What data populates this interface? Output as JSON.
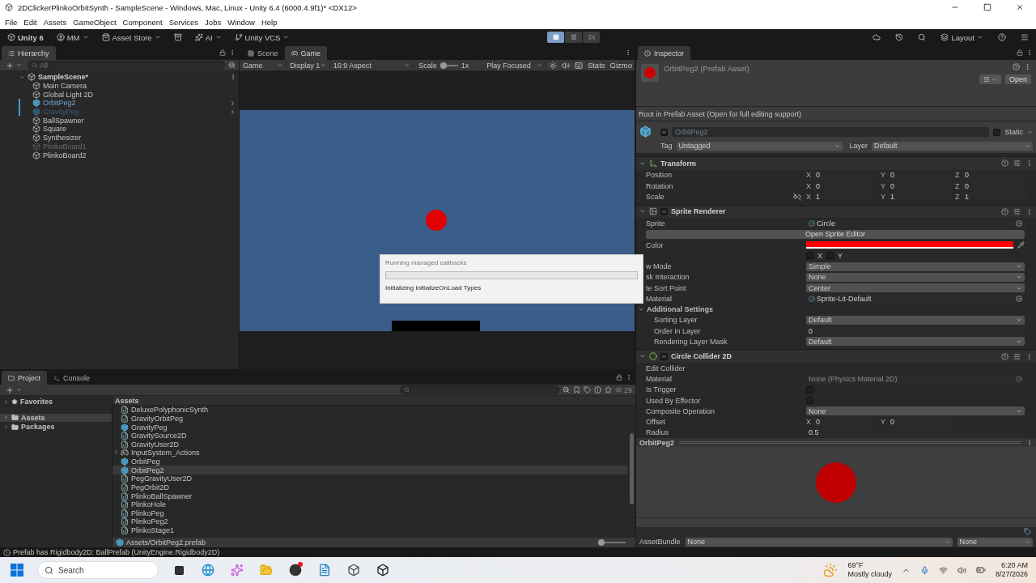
{
  "window": {
    "title": "2DClickerPlinkoOrbitSynth - SampleScene - Windows, Mac, Linux - Unity 6.4 (6000.4.9f1)* <DX12>"
  },
  "menu_bar": [
    "File",
    "Edit",
    "Assets",
    "GameObject",
    "Component",
    "Services",
    "Jobs",
    "Window",
    "Help"
  ],
  "toolbar": {
    "account": "Unity 6",
    "user": "MM",
    "asset_store": "Asset Store",
    "ai": "AI",
    "vcs": "Unity VCS",
    "layout": "Layout"
  },
  "play_controls": [
    {
      "kind": "play",
      "selected": true
    },
    {
      "kind": "pause",
      "selected": false
    },
    {
      "kind": "step",
      "selected": false
    }
  ],
  "hierarchy": {
    "tabs": [
      {
        "label": "Hierarchy",
        "selected": true
      }
    ],
    "search_placeholder": "All",
    "scene": "SampleScene*",
    "items": [
      {
        "label": "Main Camera",
        "kind": "object",
        "disabled": false
      },
      {
        "label": "Global Light 2D",
        "kind": "object",
        "disabled": false
      },
      {
        "label": "OrbitPeg2",
        "kind": "prefab",
        "disabled": false
      },
      {
        "label": "GravityPeg",
        "kind": "prefab",
        "disabled": true
      },
      {
        "label": "BallSpawner",
        "kind": "object",
        "disabled": false
      },
      {
        "label": "Square",
        "kind": "object",
        "disabled": false
      },
      {
        "label": "Synthesizer",
        "kind": "object",
        "disabled": false
      },
      {
        "label": "PlinkoBoard1",
        "kind": "object",
        "disabled": true
      },
      {
        "label": "PlinkoBoard2",
        "kind": "object",
        "disabled": false
      }
    ]
  },
  "view_tabs": [
    {
      "label": "Scene",
      "kind": "scene",
      "selected": false
    },
    {
      "label": "Game",
      "kind": "game",
      "selected": true
    }
  ],
  "game_toolbar": {
    "mode": "Game",
    "display": "Display 1",
    "aspect": "16:9 Aspect",
    "scale": {
      "label": "Scale",
      "level": 0,
      "value": "1x"
    },
    "play_focused": "Play Focused",
    "stats": "Stats",
    "gizmos": "Gizmo"
  },
  "dialog": {
    "title": "Running managed callbacks",
    "level": 0,
    "message": "Initializing InitializeOnLoad Types"
  },
  "inspector": {
    "tabs": [
      {
        "label": "Inspector",
        "selected": true
      }
    ],
    "name": "OrbitPeg2 (Prefab Asset)",
    "open": "Open",
    "note": "Root in Prefab Asset (Open for full editing support)",
    "object": {
      "active": true,
      "name": "OrbitPeg2",
      "static": false,
      "static_label": "Static",
      "tag_label": "Tag",
      "tag": "Untagged",
      "layer_label": "Layer",
      "layer": "Default"
    },
    "components": [
      {
        "kind": "transform",
        "title": "Transform",
        "expanded": true,
        "rows": [
          {
            "kind": "vector",
            "label": "Position",
            "values": [
              {
                "axis": "X",
                "value": "0"
              },
              {
                "axis": "Y",
                "value": "0"
              },
              {
                "axis": "Z",
                "value": "0"
              }
            ]
          },
          {
            "kind": "vector",
            "label": "Rotation",
            "values": [
              {
                "axis": "X",
                "value": "0"
              },
              {
                "axis": "Y",
                "value": "0"
              },
              {
                "axis": "Z",
                "value": "0"
              }
            ]
          },
          {
            "kind": "vector",
            "label": "Scale",
            "constrained": false,
            "values": [
              {
                "axis": "X",
                "value": "1"
              },
              {
                "axis": "Y",
                "value": "1"
              },
              {
                "axis": "Z",
                "value": "1"
              }
            ]
          }
        ]
      },
      {
        "kind": "sprite_renderer",
        "title": "Sprite Renderer",
        "enabled": true,
        "expanded": true,
        "rows": [
          {
            "kind": "object",
            "label": "Sprite",
            "value": "Circle",
            "empty": false
          },
          {
            "kind": "button",
            "label": "Open Sprite Editor"
          },
          {
            "kind": "color",
            "label": "Color",
            "color": "#ff0000"
          },
          {
            "kind": "flip",
            "axes": [
              {
                "axis": "X",
                "checked": false
              },
              {
                "axis": "Y",
                "checked": false
              }
            ]
          },
          {
            "kind": "dropdown",
            "label": "w Mode",
            "value": "Simple"
          },
          {
            "kind": "dropdown",
            "label": "sk Interaction",
            "value": "None"
          },
          {
            "kind": "dropdown",
            "label": "te Sort Point",
            "value": "Center"
          },
          {
            "kind": "object",
            "label": "Material",
            "value": "Sprite-Lit-Default",
            "empty": false
          },
          {
            "kind": "foldout",
            "label": "Additional Settings",
            "expanded": true,
            "children": [
              {
                "kind": "dropdown",
                "label": "Sorting Layer",
                "value": "Default"
              },
              {
                "kind": "text",
                "label": "Order in Layer",
                "value": "0"
              },
              {
                "kind": "dropdown",
                "label": "Rendering Layer Mask",
                "value": "Default"
              }
            ]
          }
        ]
      },
      {
        "kind": "circle_collider",
        "title": "Circle Collider 2D",
        "enabled": true,
        "expanded": true,
        "rows": [
          {
            "kind": "label",
            "label": "Edit Collider"
          },
          {
            "kind": "object",
            "label": "Material",
            "value": "None (Physics Material 2D)",
            "empty": true
          },
          {
            "kind": "toggle",
            "label": "Is Trigger",
            "checked": false
          },
          {
            "kind": "toggle",
            "label": "Used By Effector",
            "checked": false
          },
          {
            "kind": "dropdown",
            "label": "Composite Operation",
            "value": "None"
          },
          {
            "kind": "vector",
            "label": "Offset",
            "values": [
              {
                "axis": "X",
                "value": "0"
              },
              {
                "axis": "Y",
                "value": "0"
              }
            ]
          },
          {
            "kind": "text",
            "label": "Radius",
            "value": "0.5"
          }
        ]
      }
    ],
    "preview_title": "OrbitPeg2",
    "asset_bundle": {
      "label": "AssetBundle",
      "name": "None",
      "variant": "None"
    }
  },
  "project": {
    "tabs": [
      {
        "label": "Project",
        "kind": "project",
        "selected": true
      },
      {
        "label": "Console",
        "kind": "console",
        "selected": false
      }
    ],
    "count": "29",
    "tree": [
      {
        "label": "Favorites",
        "kind": "favorites",
        "selected": false
      },
      {
        "label": "Assets",
        "kind": "folder",
        "selected": true
      },
      {
        "label": "Packages",
        "kind": "folder",
        "selected": false
      }
    ],
    "breadcrumb": "Assets",
    "files": [
      {
        "name": "DeluxePolyphonicSynth",
        "kind": "script",
        "selected": false
      },
      {
        "name": "GravityOrbitPeg",
        "kind": "script",
        "selected": false
      },
      {
        "name": "GravityPeg",
        "kind": "prefab",
        "selected": false
      },
      {
        "name": "GravitySource2D",
        "kind": "script",
        "selected": false
      },
      {
        "name": "GravityUser2D",
        "kind": "script",
        "selected": false
      },
      {
        "name": "InputSystem_Actions",
        "kind": "actions",
        "selected": false
      },
      {
        "name": "OrbitPeg",
        "kind": "prefab",
        "selected": false
      },
      {
        "name": "OrbitPeg2",
        "kind": "prefab",
        "selected": true
      },
      {
        "name": "PegGravityUser2D",
        "kind": "script",
        "selected": false
      },
      {
        "name": "PegOrbit2D",
        "kind": "script",
        "selected": false
      },
      {
        "name": "PlinkoBallSpawner",
        "kind": "script",
        "selected": false
      },
      {
        "name": "PlinkoHole",
        "kind": "script",
        "selected": false
      },
      {
        "name": "PlinkoPeg",
        "kind": "script",
        "selected": false
      },
      {
        "name": "PlinkoPeg2",
        "kind": "script",
        "selected": false
      },
      {
        "name": "PlinkoStage1",
        "kind": "script",
        "selected": false
      }
    ],
    "path": "Assets/OrbitPeg2.prefab",
    "icon_size": {
      "level": 0
    }
  },
  "status_bar": {
    "message": "Prefab has Rigidbody2D: BallPrefab (UnityEngine.Rigidbody2D)"
  },
  "taskbar": {
    "search_placeholder": "Search",
    "temperature": "69°F",
    "weather": "Mostly cloudy",
    "time": "6:20 AM",
    "date": "8/27/2026"
  }
}
